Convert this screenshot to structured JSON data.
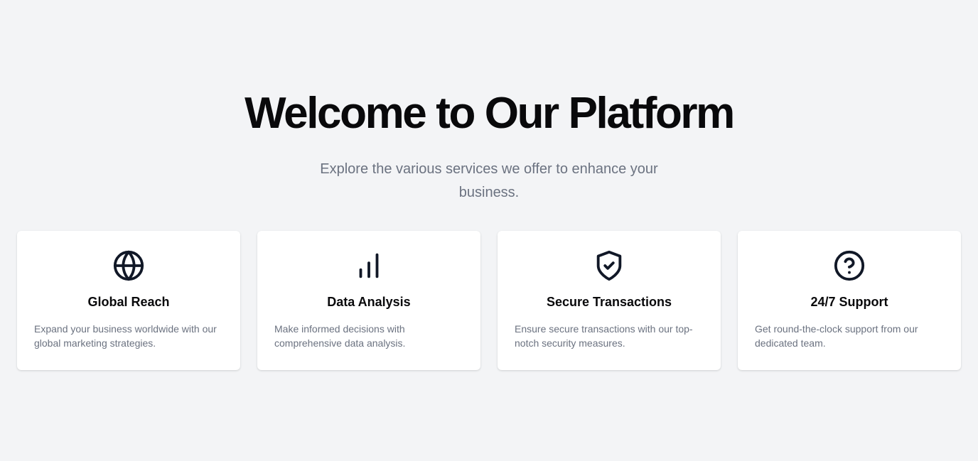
{
  "hero": {
    "title": "Welcome to Our Platform",
    "subtitle": "Explore the various services we offer to enhance your business."
  },
  "cards": [
    {
      "icon": "globe-icon",
      "title": "Global Reach",
      "description": "Expand your business worldwide with our global marketing strategies."
    },
    {
      "icon": "bar-chart-icon",
      "title": "Data Analysis",
      "description": "Make informed decisions with comprehensive data analysis."
    },
    {
      "icon": "shield-check-icon",
      "title": "Secure Transactions",
      "description": "Ensure secure transactions with our top-notch security measures."
    },
    {
      "icon": "help-circle-icon",
      "title": "24/7 Support",
      "description": "Get round-the-clock support from our dedicated team."
    }
  ],
  "colors": {
    "background": "#f3f4f6",
    "card_background": "#ffffff",
    "title_text": "#09090b",
    "muted_text": "#6b7280",
    "icon_stroke": "#111827"
  }
}
